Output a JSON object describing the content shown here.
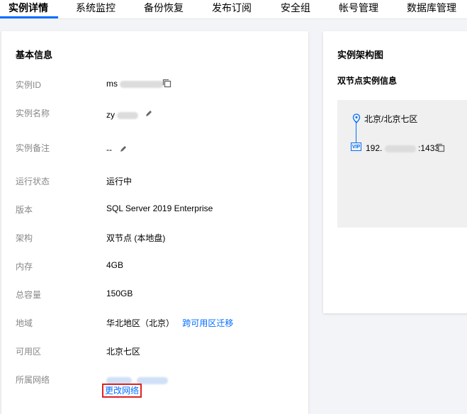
{
  "tabs": [
    {
      "label": "实例详情"
    },
    {
      "label": "系统监控"
    },
    {
      "label": "备份恢复"
    },
    {
      "label": "发布订阅"
    },
    {
      "label": "安全组"
    },
    {
      "label": "帐号管理"
    },
    {
      "label": "数据库管理"
    }
  ],
  "basic_info": {
    "title": "基本信息",
    "rows": [
      {
        "label": "实例ID",
        "value": "ms"
      },
      {
        "label": "实例名称",
        "value": "zy"
      },
      {
        "label": "实例备注",
        "value": "--"
      },
      {
        "label": "运行状态",
        "value": "运行中"
      },
      {
        "label": "版本",
        "value": "SQL Server 2019 Enterprise"
      },
      {
        "label": "架构",
        "value": "双节点 (本地盘)"
      },
      {
        "label": "内存",
        "value": "4GB"
      },
      {
        "label": "总容量",
        "value": "150GB"
      },
      {
        "label": "地域",
        "value": "华北地区（北京）",
        "link": "跨可用区迁移"
      },
      {
        "label": "可用区",
        "value": "北京七区"
      },
      {
        "label": "所属网络",
        "value": "",
        "link": "更改网络"
      }
    ]
  },
  "architecture": {
    "title": "实例架构图",
    "subtitle": "双节点实例信息",
    "region": "北京/北京七区",
    "vip_badge": "VIP",
    "vip_prefix": "192.",
    "vip_port": ":1433"
  },
  "colors": {
    "accent": "#006eff",
    "highlight_border": "#e02020"
  },
  "icons": [
    "copy-icon",
    "edit-icon",
    "location-pin-icon"
  ]
}
